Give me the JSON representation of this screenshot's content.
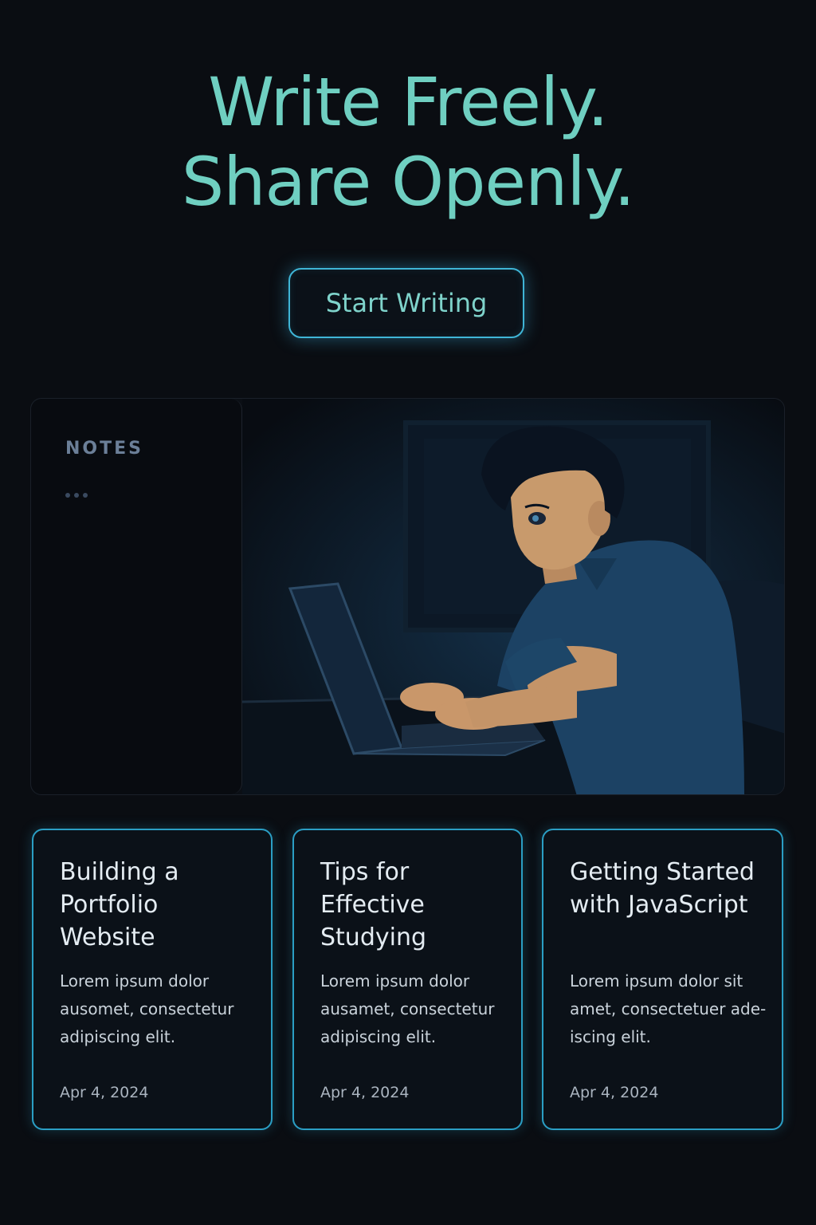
{
  "hero": {
    "title_line1": "Write Freely.",
    "title_line2": "Share Openly.",
    "cta_label": "Start Writing"
  },
  "notes": {
    "heading": "NOTES",
    "dots": "..."
  },
  "illustration": {
    "icon": "person-typing-on-laptop-illustration"
  },
  "posts": [
    {
      "title": "Building a Portfolio Website",
      "excerpt": "Lorem ipsum dolor ausomet, consectetur adipiscing elit.",
      "date": "Apr 4, 2024"
    },
    {
      "title": "Tips for Effective Studying",
      "excerpt": "Lorem ipsum dolor ausamet, consectetur adipiscing elit.",
      "date": "Apr 4, 2024"
    },
    {
      "title": "Getting Started with JavaScript",
      "excerpt": "Lorem ipsum dolor sit amet, consectetuer ade-iscing elit.",
      "date": "Apr 4, 2024"
    }
  ],
  "colors": {
    "background": "#0a0d12",
    "accent_teal": "#6fcfc1",
    "accent_blue_border": "#2b9ec4"
  }
}
